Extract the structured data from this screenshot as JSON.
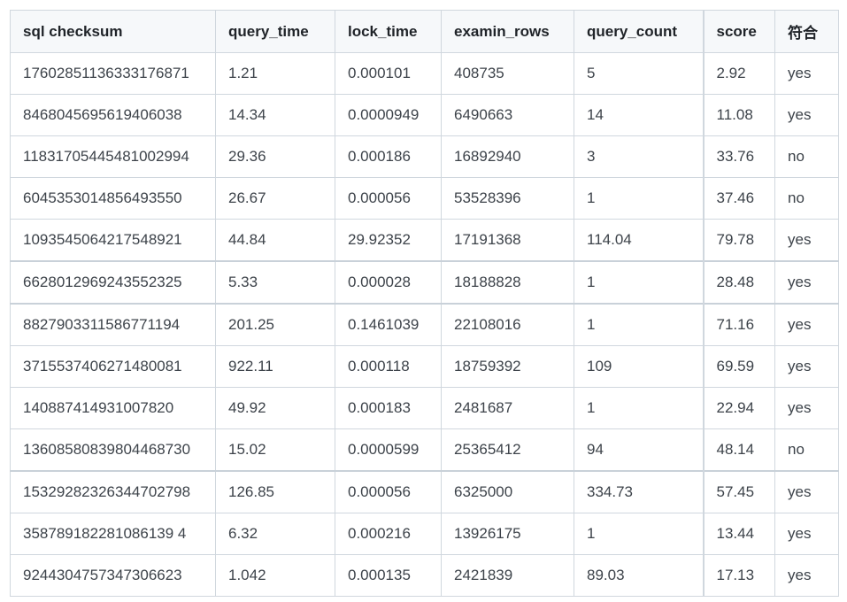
{
  "table": {
    "headers": [
      "sql checksum",
      "query_time",
      "lock_time",
      "examin_rows",
      "query_count",
      "score",
      "符合"
    ],
    "rows": [
      [
        "17602851136333176871",
        "1.21",
        "0.000101",
        "408735",
        "5",
        "2.92",
        "yes"
      ],
      [
        "8468045695619406038",
        "14.34",
        "0.0000949",
        "6490663",
        "14",
        "11.08",
        "yes"
      ],
      [
        "11831705445481002994",
        "29.36",
        "0.000186",
        "16892940",
        "3",
        "33.76",
        "no"
      ],
      [
        "6045353014856493550",
        "26.67",
        "0.000056",
        "53528396",
        "1",
        "37.46",
        "no"
      ],
      [
        "1093545064217548921",
        "44.84",
        "29.92352",
        "17191368",
        "114.04",
        "79.78",
        "yes"
      ],
      [
        "6628012969243552325",
        "5.33",
        "0.000028",
        "18188828",
        "1",
        "28.48",
        "yes"
      ],
      [
        "8827903311586771194",
        "201.25",
        "0.1461039",
        "22108016",
        "1",
        "71.16",
        "yes"
      ],
      [
        "3715537406271480081",
        "922.11",
        "0.000118",
        "18759392",
        "109",
        "69.59",
        "yes"
      ],
      [
        "140887414931007820",
        "49.92",
        "0.000183",
        "2481687",
        "1",
        "22.94",
        "yes"
      ],
      [
        "13608580839804468730",
        "15.02",
        "0.0000599",
        "25365412",
        "94",
        "48.14",
        "no"
      ],
      [
        "15329282326344702798",
        "126.85",
        "0.000056",
        "6325000",
        "334.73",
        "57.45",
        "yes"
      ],
      [
        "358789182281086139 4",
        "6.32",
        "0.000216",
        "13926175",
        "1",
        "13.44",
        "yes"
      ],
      [
        "9244304757347306623",
        "1.042",
        "0.000135",
        "2421839",
        "89.03",
        "17.13",
        "yes"
      ]
    ]
  }
}
